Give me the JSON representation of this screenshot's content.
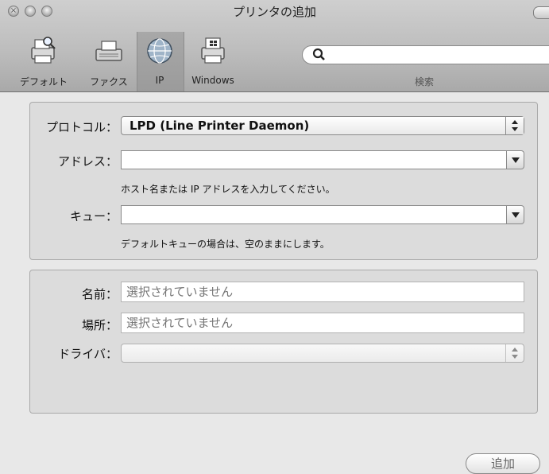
{
  "window": {
    "title": "プリンタの追加"
  },
  "toolbar": {
    "items": [
      {
        "label": "デフォルト",
        "icon": "printer-magnifier-icon"
      },
      {
        "label": "ファクス",
        "icon": "fax-icon"
      },
      {
        "label": "IP",
        "icon": "globe-icon",
        "selected": true
      },
      {
        "label": "Windows",
        "icon": "windows-printer-icon"
      }
    ],
    "search": {
      "placeholder": "",
      "caption": "検索"
    }
  },
  "connection": {
    "protocol_label": "プロトコル：",
    "protocol_value": "LPD (Line Printer Daemon)",
    "address_label": "アドレス：",
    "address_value": "",
    "address_hint": "ホスト名または IP アドレスを入力してください。",
    "queue_label": "キュー：",
    "queue_value": "",
    "queue_hint": "デフォルトキューの場合は、空のままにします。"
  },
  "printer_info": {
    "name_label": "名前：",
    "name_placeholder": "選択されていません",
    "location_label": "場所：",
    "location_placeholder": "選択されていません",
    "driver_label": "ドライバ：",
    "driver_value": ""
  },
  "actions": {
    "add_label": "追加"
  },
  "colors": {
    "toolbar_top": "#cfcfcf",
    "toolbar_bottom": "#a9a9a9",
    "window_bg": "#e8e8e8",
    "panel_bg": "#dcdcdc"
  }
}
